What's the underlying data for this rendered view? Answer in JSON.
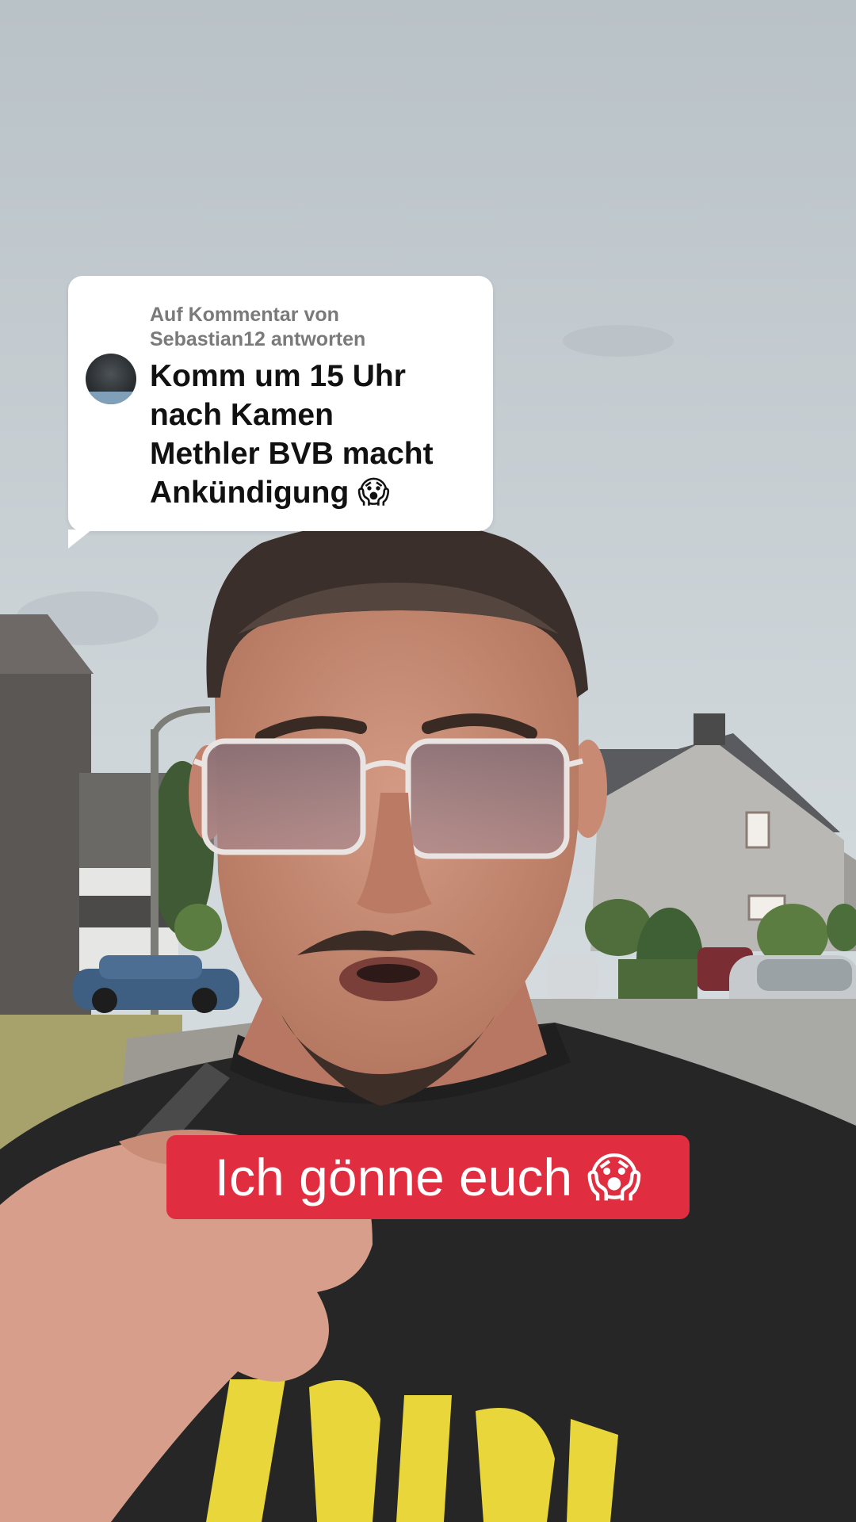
{
  "reply_card": {
    "header_line1": "Auf Kommentar von",
    "header_line2": "Sebastian12 antworten",
    "comment_line1": "Komm um 15 Uhr",
    "comment_line2": "nach Kamen",
    "comment_line3": "Methler BVB macht",
    "comment_line4": "Ankündigung",
    "comment_emoji": "😱"
  },
  "caption": {
    "text": "Ich gönne euch",
    "emoji": "😱"
  },
  "colors": {
    "caption_background": "#e02d3f",
    "card_background": "#ffffff",
    "header_text": "#7a7a7a",
    "comment_text": "#111111"
  }
}
